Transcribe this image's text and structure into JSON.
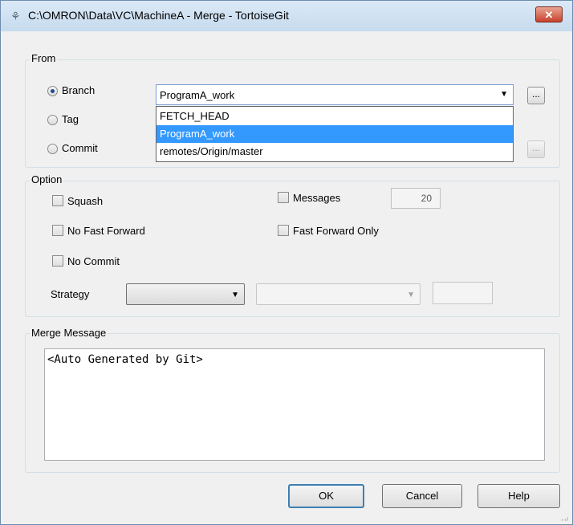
{
  "window": {
    "title": "C:\\OMRON\\Data\\VC\\MachineA - Merge - TortoiseGit",
    "close_label": "✕"
  },
  "from": {
    "label": "From",
    "branch_label": "Branch",
    "tag_label": "Tag",
    "commit_label": "Commit",
    "branch_value": "ProgramA_work",
    "browse_label": "...",
    "dropdown_options": [
      "FETCH_HEAD",
      "ProgramA_work",
      "remotes/Origin/master"
    ],
    "selected_option": "ProgramA_work"
  },
  "option": {
    "label": "Option",
    "squash_label": "Squash",
    "no_ff_label": "No Fast Forward",
    "no_commit_label": "No Commit",
    "messages_label": "Messages",
    "messages_value": "20",
    "ff_only_label": "Fast Forward Only",
    "strategy_label": "Strategy"
  },
  "merge_message": {
    "label": "Merge Message",
    "text": "<Auto Generated by Git>"
  },
  "buttons": {
    "ok": "OK",
    "cancel": "Cancel",
    "help": "Help"
  },
  "colors": {
    "selection": "#3399ff",
    "close_button": "#c7422c"
  }
}
